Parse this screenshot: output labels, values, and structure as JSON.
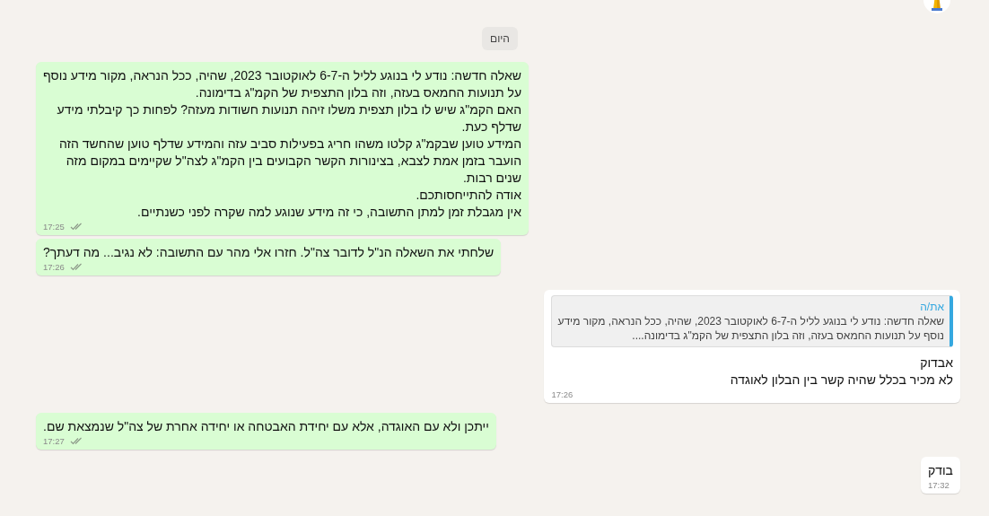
{
  "day_chip": "היום",
  "messages": [
    {
      "kind": "sent",
      "lines": [
        "שאלה חדשה: נודע לי בנוגע לליל ה-6-7 לאוקטובר 2023, שהיה, ככל הנראה, מקור מידע נוסף",
        "על תנועות החמאס בעזה, וזה בלון התצפית של הקמ\"ג בדימונה.",
        "האם הקמ\"ג שיש לו בלון תצפית משלו זיהה תנועות חשודות מעזה? לפחות כך קיבלתי מידע",
        "שדלף כעת.",
        "המידע טוען שבקמ\"ג קלטו משהו חריג בפעילות סביב עזה והמידע שדלף טוען שהחשד הזה",
        "הועבר בזמן אמת לצבא, בצינורות הקשר הקבועים בין הקמ\"ג לצה\"ל שקיימים במקום מזה",
        "שנים רבות.",
        "אודה להתייחסותכם.",
        "אין מגבלת זמן למתן התשובה, כי זה מידע שנוגע למה שקרה לפני כשנתיים."
      ],
      "time": "17:25",
      "read": true
    },
    {
      "kind": "sent",
      "lines": [
        "שלחתי את השאלה הנ\"ל לדובר צה\"ל. חזרו אלי מהר עם התשובה: לא נגיב... מה דעתך?"
      ],
      "time": "17:26",
      "read": true
    },
    {
      "kind": "received",
      "quote": {
        "sender": "את/ה",
        "lines": [
          "שאלה חדשה: נודע לי בנוגע לליל ה-6-7 לאוקטובר 2023, שהיה, ככל הנראה, מקור מידע",
          "נוסף על תנועות החמאס בעזה, וזה בלון התצפית של הקמ\"ג בדימונה...."
        ]
      },
      "lines": [
        "אבדוק",
        "לא מכיר בכלל שהיה קשר בין הבלון לאוגדה"
      ],
      "time": "17:26"
    },
    {
      "kind": "sent",
      "lines": [
        "ייתכן ולא עם האוגדה, אלא עם יחידת האבטחה או יחידה אחרת של צה\"ל שנמצאת שם."
      ],
      "time": "17:27",
      "read": true
    },
    {
      "kind": "received",
      "lines": [
        "בודק"
      ],
      "time": "17:32"
    }
  ]
}
